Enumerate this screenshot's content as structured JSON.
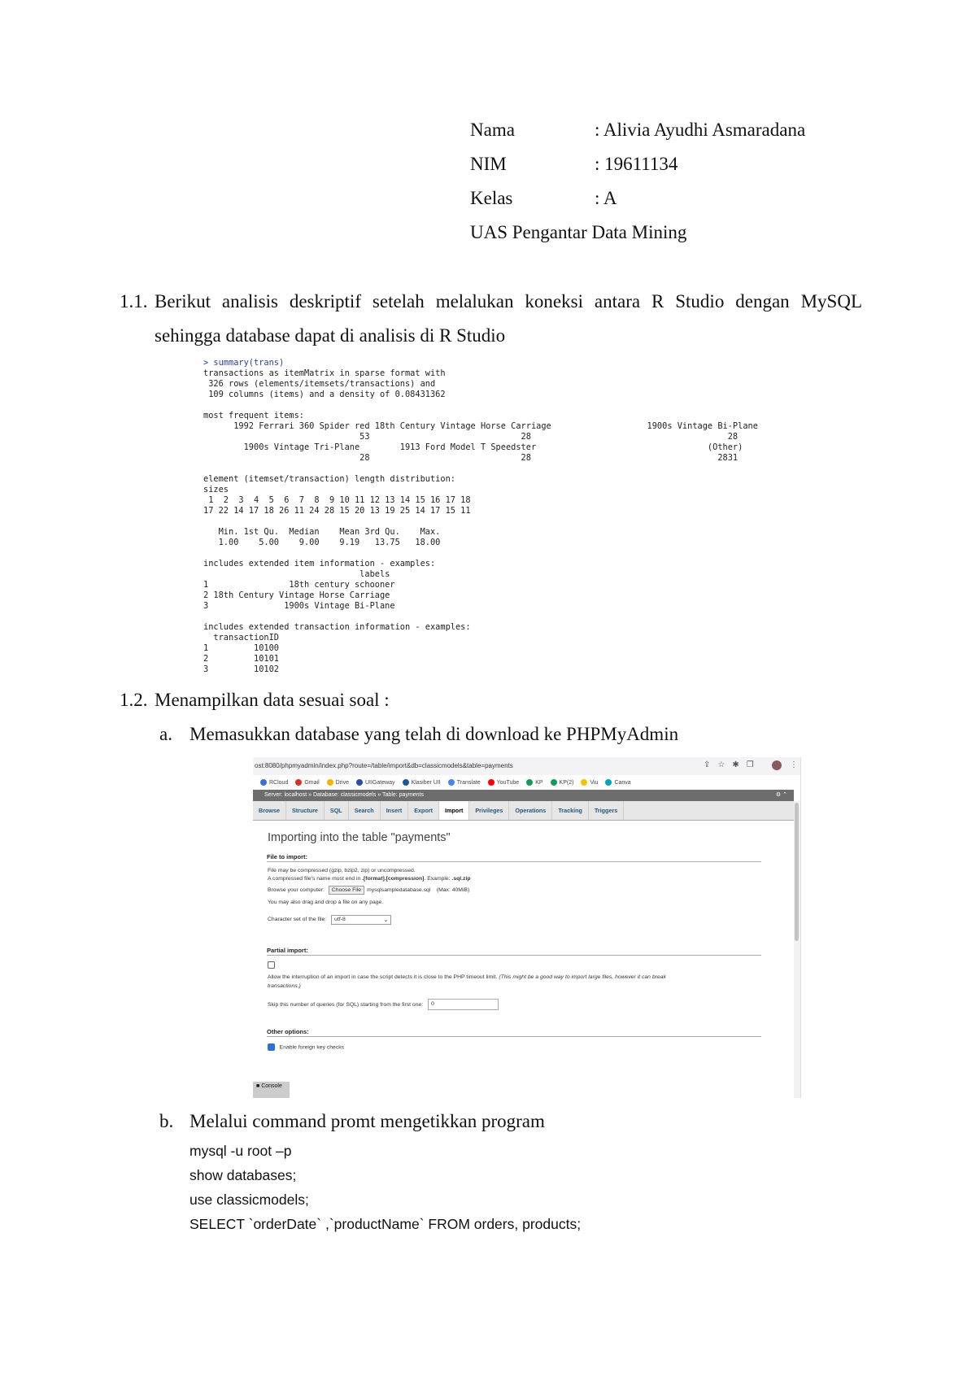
{
  "header": {
    "rows": [
      {
        "label": "Nama",
        "value": ": Alivia Ayudhi Asmaradana"
      },
      {
        "label": "NIM",
        "value": ": 19611134"
      },
      {
        "label": "Kelas",
        "value": ": A"
      }
    ],
    "subtitle": "UAS Pengantar Data Mining"
  },
  "section_1_1": {
    "number": "1.1.",
    "line1": "Berikut analisis deskriptif setelah melalukan koneksi antara R Studio dengan MySQL",
    "line2": "sehingga database dapat di analisis di R Studio"
  },
  "r_output": {
    "command": "> summary(trans)",
    "body": "transactions as itemMatrix in sparse format with\n 326 rows (elements/itemsets/transactions) and\n 109 columns (items) and a density of 0.08431362 \n\nmost frequent items:\n      1992 Ferrari 360 Spider red 18th Century Vintage Horse Carriage                   1900s Vintage Bi-Plane \n                               53                              28                                       28 \n        1900s Vintage Tri-Plane        1913 Ford Model T Speedster                                  (Other) \n                               28                              28                                     2831 \n\nelement (itemset/transaction) length distribution:\nsizes\n 1  2  3  4  5  6  7  8  9 10 11 12 13 14 15 16 17 18 \n17 22 14 17 18 26 11 24 28 15 20 13 19 25 14 17 15 11 \n\n   Min. 1st Qu.  Median    Mean 3rd Qu.    Max. \n   1.00    5.00    9.00    9.19   13.75   18.00 \n\nincludes extended item information - examples:\n                               labels\n1                18th century schooner\n2 18th Century Vintage Horse Carriage\n3               1900s Vintage Bi-Plane\n\nincludes extended transaction information - examples:\n  transactionID\n1         10100\n2         10101\n3         10102"
  },
  "section_1_2": {
    "number": "1.2.",
    "title": "Menampilkan data sesuai soal :",
    "item_a": {
      "letter": "a.",
      "text": "Memasukkan database yang telah di download ke PHPMyAdmin"
    },
    "item_b": {
      "letter": "b.",
      "text": "Melalui command promt mengetikkan program"
    },
    "code_lines": [
      "mysql -u root –p",
      "show databases;",
      "use classicmodels;",
      "SELECT `orderDate` ,`productName` FROM orders, products;"
    ]
  },
  "screenshot": {
    "url": "ost:8080/phpmyadmin/index.php?route=/table/import&db=classicmodels&table=payments",
    "bookmarks": [
      {
        "label": "RCloud",
        "color": "#3b6fd8"
      },
      {
        "label": "Gmail",
        "color": "#d93025"
      },
      {
        "label": "Drive",
        "color": "#f4b400"
      },
      {
        "label": "UIIGateway",
        "color": "#2a4fa0"
      },
      {
        "label": "Klasiber UII",
        "color": "#1a5a9a"
      },
      {
        "label": "Translate",
        "color": "#4285f4"
      },
      {
        "label": "YouTube",
        "color": "#ff0000"
      },
      {
        "label": "KP",
        "color": "#0f9d58"
      },
      {
        "label": "KP(2)",
        "color": "#0f9d58"
      },
      {
        "label": "Viu",
        "color": "#f5c200"
      },
      {
        "label": "Canva",
        "color": "#00a3c4"
      }
    ],
    "breadcrumb": [
      "Server: localhost",
      "Database: classicmodels",
      "Table: payments"
    ],
    "tabs": [
      "Browse",
      "Structure",
      "SQL",
      "Search",
      "Insert",
      "Export",
      "Import",
      "Privileges",
      "Operations",
      "Tracking",
      "Triggers"
    ],
    "active_tab": "Import",
    "heading": "Importing into the table \"payments\"",
    "file_section": "File to import:",
    "file_note1": "File may be compressed (gzip, bzip2, zip) or uncompressed.",
    "file_note2_pre": "A compressed file's name must end in ",
    "file_note2_bold": ".[format].[compression]",
    "file_note2_mid": ". Example: ",
    "file_note2_ex": ".sql.zip",
    "browse_label": "Browse your computer:",
    "choose_file": "Choose File",
    "file_name": "mysqlsampledatabase.sql",
    "max_size": "(Max: 40MiB)",
    "drag_note": "You may also drag and drop a file on any page.",
    "charset_label": "Character set of the file:",
    "charset_value": "utf-8",
    "partial_section": "Partial import:",
    "allow_text": "Allow the interruption of an import in case the script detects it is close to the PHP timeout limit.",
    "allow_italic": "(This might be a good way to import large files, however it can break",
    "allow_italic2": "transactions.)",
    "allow_checked": false,
    "skip_label": "Skip this number of queries (for SQL) starting from the first one:",
    "skip_value": "0",
    "other_section": "Other options:",
    "fk_label": "Enable foreign key checks",
    "fk_checked": true,
    "console": "Console"
  }
}
